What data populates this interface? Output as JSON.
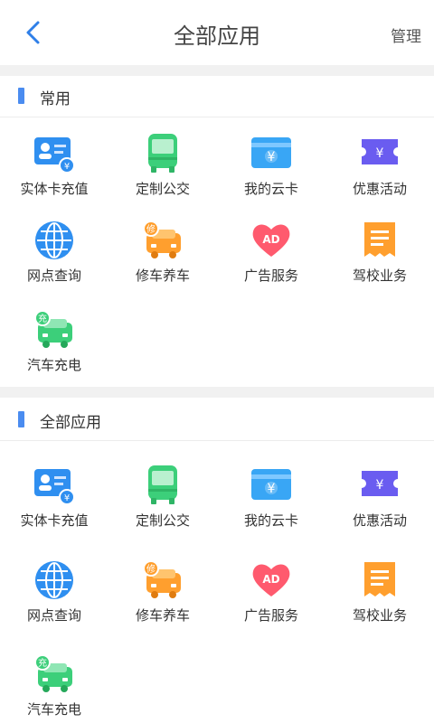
{
  "header": {
    "title": "全部应用",
    "manage_label": "管理"
  },
  "sections": [
    {
      "title": "常用",
      "items": [
        {
          "label": "实体卡充值",
          "icon": "card-recharge-icon"
        },
        {
          "label": "定制公交",
          "icon": "bus-icon"
        },
        {
          "label": "我的云卡",
          "icon": "cloud-card-icon"
        },
        {
          "label": "优惠活动",
          "icon": "coupon-icon"
        },
        {
          "label": "网点查询",
          "icon": "globe-icon"
        },
        {
          "label": "修车养车",
          "icon": "car-repair-icon"
        },
        {
          "label": "广告服务",
          "icon": "ad-heart-icon"
        },
        {
          "label": "驾校业务",
          "icon": "driving-school-icon"
        },
        {
          "label": "汽车充电",
          "icon": "car-charge-icon"
        }
      ]
    },
    {
      "title": "全部应用",
      "items": [
        {
          "label": "实体卡充值",
          "icon": "card-recharge-icon"
        },
        {
          "label": "定制公交",
          "icon": "bus-icon"
        },
        {
          "label": "我的云卡",
          "icon": "cloud-card-icon"
        },
        {
          "label": "优惠活动",
          "icon": "coupon-icon"
        },
        {
          "label": "网点查询",
          "icon": "globe-icon"
        },
        {
          "label": "修车养车",
          "icon": "car-repair-icon"
        },
        {
          "label": "广告服务",
          "icon": "ad-heart-icon"
        },
        {
          "label": "驾校业务",
          "icon": "driving-school-icon"
        },
        {
          "label": "汽车充电",
          "icon": "car-charge-icon"
        }
      ]
    }
  ],
  "icon_badges": {
    "card_yen": "¥",
    "cloud_yen": "¥",
    "coupon_yen": "¥",
    "repair_badge": "修",
    "ad_text": "AD",
    "charge_badge": "充"
  },
  "colors": {
    "accent": "#4a8cf0",
    "bus_green": "#3ccf7a",
    "orange": "#ff9f2e",
    "red": "#ff5a6e",
    "purple": "#6a5cf0",
    "blue": "#2f8ff0"
  }
}
